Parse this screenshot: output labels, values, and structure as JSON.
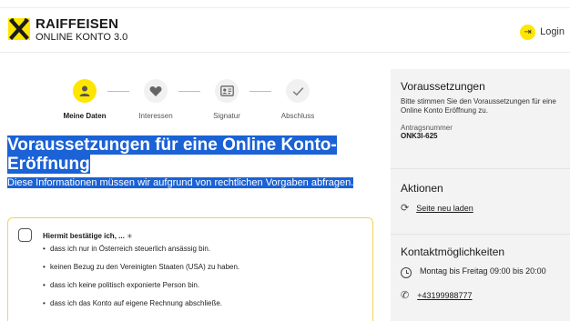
{
  "header": {
    "brand_name": "RAIFFEISEN",
    "brand_sub": "ONLINE KONTO 3.0",
    "login_label": "Login",
    "logo_icon": "raiffeisen-crossed-horses-logo",
    "login_icon": "login-arrow-icon",
    "accent_color": "#fee600"
  },
  "stepper": {
    "steps": [
      {
        "label": "Meine Daten",
        "icon": "person-icon",
        "active": true
      },
      {
        "label": "Interessen",
        "icon": "heart-icon",
        "active": false
      },
      {
        "label": "Signatur",
        "icon": "id-card-icon",
        "active": false
      },
      {
        "label": "Abschluss",
        "icon": "check-icon",
        "active": false
      }
    ]
  },
  "main": {
    "headline": "Voraussetzungen für eine Online Konto-Eröffnung",
    "subline": "Diese Informationen müssen wir aufgrund von rechtlichen Vorgaben abfragen.",
    "selection_color": "#1a62d6",
    "confirm": {
      "title": "Hiermit bestätige ich, ...",
      "required_mark": "∗",
      "checked": false,
      "conditions": [
        "dass ich nur in Österreich steuerlich ansässig bin.",
        "keinen Bezug zu den Vereinigten Staaten (USA) zu haben.",
        "dass ich keine politisch exponierte Person bin.",
        "dass ich das Konto auf eigene Rechnung abschließe."
      ]
    }
  },
  "aside": {
    "prereq": {
      "title": "Voraussetzungen",
      "text": "Bitte stimmen Sie den Voraussetzungen für eine Online Konto Eröffnung zu.",
      "app_label": "Antragsnummer",
      "app_number": "ONK3I-625"
    },
    "actions": {
      "title": "Aktionen",
      "reload_label": "Seite neu laden",
      "reload_icon": "reload-icon"
    },
    "contact": {
      "title": "Kontaktmöglichkeiten",
      "hours": "Montag bis Freitag 09:00 bis 20:00",
      "phone": "+43199988777",
      "clock_icon": "clock-icon",
      "phone_icon": "phone-icon"
    }
  }
}
